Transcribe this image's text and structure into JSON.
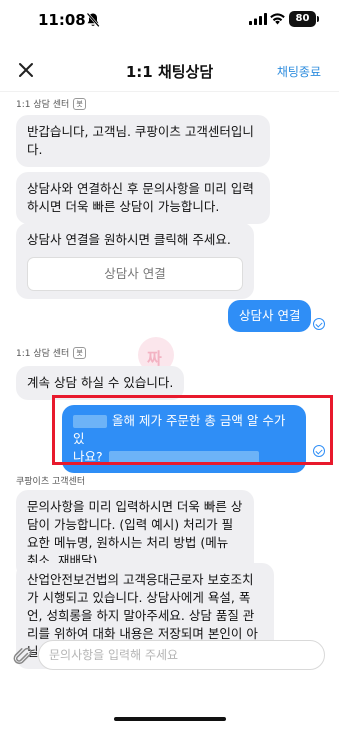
{
  "status_bar": {
    "time": "11:08",
    "battery": "80"
  },
  "header": {
    "title": "1:1 채팅상담",
    "end_chat": "채팅종료"
  },
  "bot_label": {
    "sender": "1:1 상담 센터",
    "badge": "봇"
  },
  "messages": {
    "greeting": "반갑습니다, 고객님. 쿠팡이츠 고객센터입니다.",
    "connect_tip": "상담사와 연결하신 후 문의사항을 미리 입력하시면 더욱 빠른 상담이 가능합니다.",
    "connect_prompt": "상담사 연결을 원하시면 클릭해 주세요.",
    "connect_button": "상담사 연결",
    "user_connect": "상담사 연결",
    "continue": "계속 상담 하실 수 있습니다.",
    "user_question_line1": "올해 제가 주문한 총 금액 알 수가 있",
    "user_question_line2": "나요?",
    "center_label": "쿠팡이츠 고객센터",
    "prefill_guide": "문의사항을 미리 입력하시면 더욱 빠른 상담이 가능합니다. (입력 예시) 처리가 필요한 메뉴명, 원하시는 처리 방법 (메뉴 취소, 재배달)",
    "law_notice": "산업안전보건법의 고객응대근로자 보호조치가 시행되고 있습니다. 상담사에게 욕설, 폭언, 성희롱을 하지 말아주세요. 상담 품질 관리를 위하여 대화 내용은 저장되며 본인이 아닐 경우 상담이 제한될 수 있습니다."
  },
  "input": {
    "placeholder": "문의사항을 입력해 주세요",
    "value": ""
  },
  "icons": {
    "close": "close-icon",
    "attach": "paperclip-icon",
    "read": "check-circle-icon",
    "signal": "cellular-signal-icon",
    "wifi": "wifi-icon",
    "bell": "bell-off-icon"
  },
  "colors": {
    "accent": "#2f8ef6",
    "bubble_in": "#efeff2",
    "highlight": "#e8192c",
    "link": "#2f8dde"
  }
}
